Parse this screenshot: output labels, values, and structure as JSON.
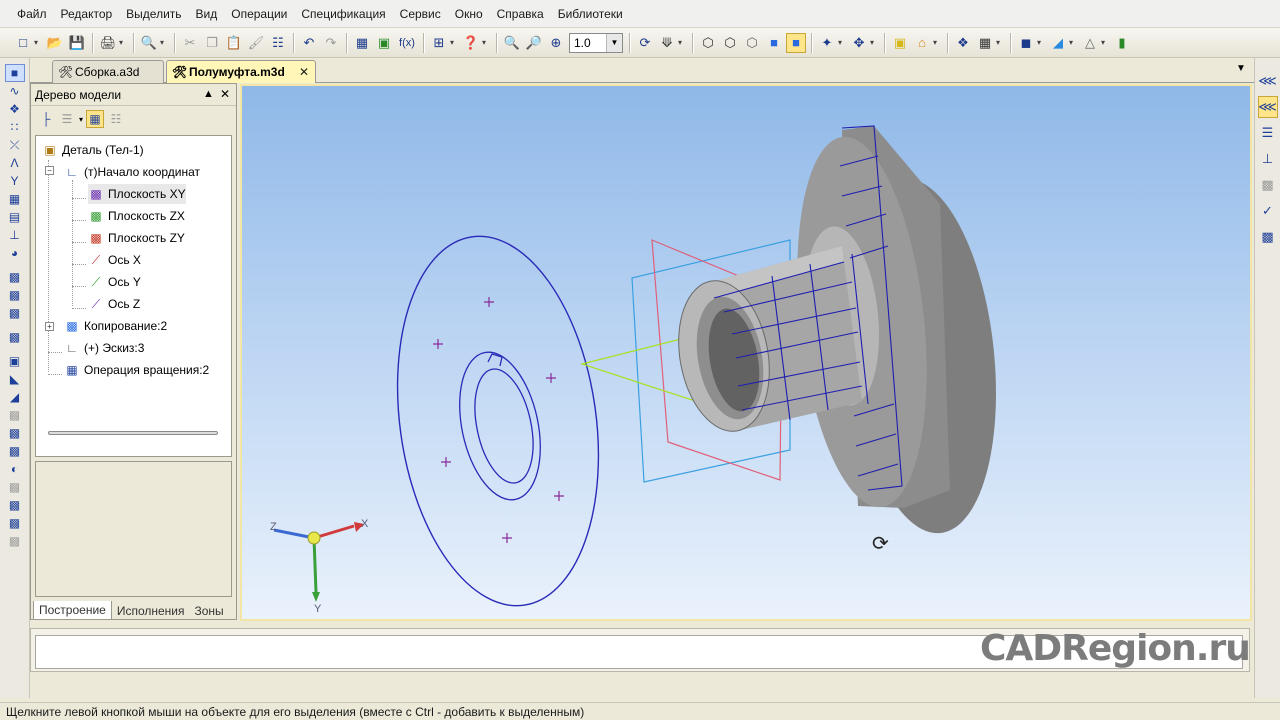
{
  "menu": [
    {
      "label": "Файл"
    },
    {
      "label": "Редактор"
    },
    {
      "label": "Выделить"
    },
    {
      "label": "Вид"
    },
    {
      "label": "Операции"
    },
    {
      "label": "Спецификация"
    },
    {
      "label": "Сервис"
    },
    {
      "label": "Окно"
    },
    {
      "label": "Справка"
    },
    {
      "label": "Библиотеки"
    }
  ],
  "toolbar": {
    "zoom_value": "1.0",
    "fx_label": "f(x)"
  },
  "tabs": [
    {
      "label": "Сборка.a3d",
      "active": false
    },
    {
      "label": "Полумуфта.m3d",
      "active": true
    }
  ],
  "tree": {
    "title": "Дерево модели",
    "items": [
      {
        "label": "Деталь (Тел-1)"
      },
      {
        "label": "(т)Начало координат"
      },
      {
        "label": "Плоскость XY"
      },
      {
        "label": "Плоскость ZX"
      },
      {
        "label": "Плоскость ZY"
      },
      {
        "label": "Ось X"
      },
      {
        "label": "Ось Y"
      },
      {
        "label": "Ось Z"
      },
      {
        "label": "Копирование:2"
      },
      {
        "label": "(+) Эскиз:3"
      },
      {
        "label": "Операция вращения:2"
      }
    ],
    "bottom_tabs": [
      {
        "label": "Построение",
        "active": true
      },
      {
        "label": "Исполнения",
        "active": false
      },
      {
        "label": "Зоны",
        "active": false
      }
    ]
  },
  "axes": {
    "x": "X",
    "y": "Y",
    "z": "Z"
  },
  "watermark": "CADRegion.ru",
  "status": "Щелкните левой кнопкой мыши на объекте для его выделения (вместе с Ctrl - добавить к выделенным)",
  "colors": {
    "sketch_blue": "#2a2ab8",
    "plane_red": "#e0607a",
    "plane_cyan": "#3aa0e0",
    "plane_green": "#a8e020",
    "model_gray": "#8c8c8c"
  }
}
